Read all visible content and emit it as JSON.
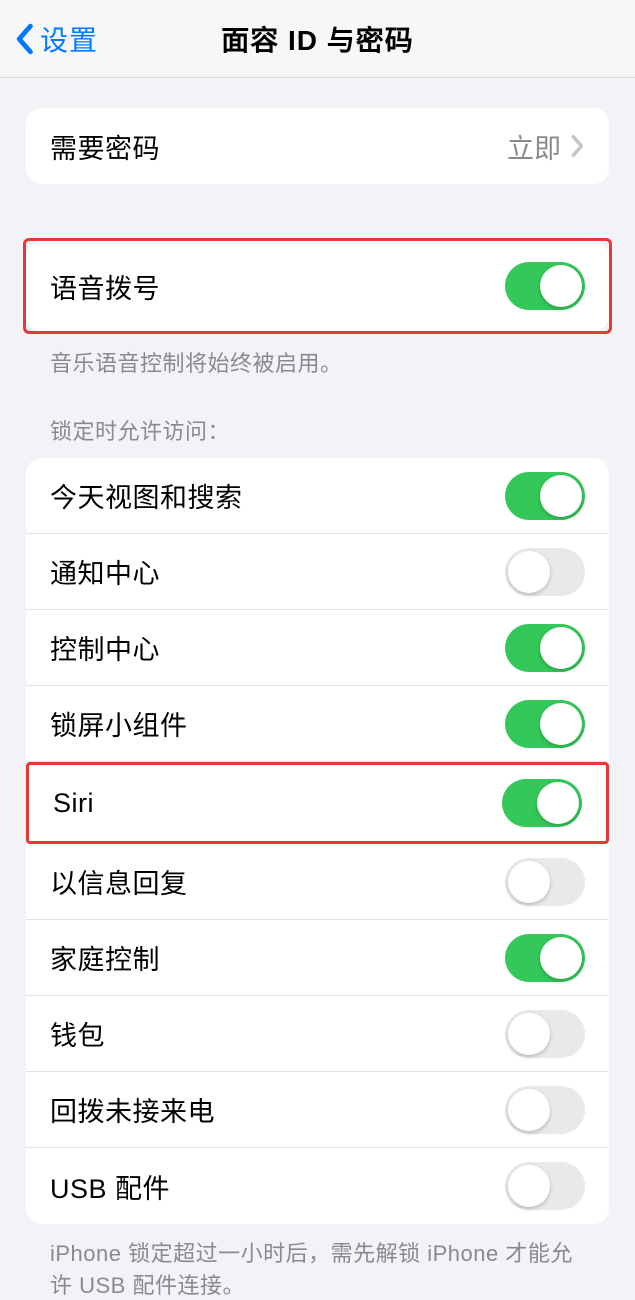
{
  "nav": {
    "back_label": "设置",
    "title": "面容 ID 与密码"
  },
  "require_passcode": {
    "label": "需要密码",
    "value": "立即"
  },
  "voice_dial": {
    "label": "语音拨号",
    "on": true,
    "footer": "音乐语音控制将始终被启用。"
  },
  "allow_access": {
    "header": "锁定时允许访问：",
    "items": [
      {
        "label": "今天视图和搜索",
        "on": true
      },
      {
        "label": "通知中心",
        "on": false
      },
      {
        "label": "控制中心",
        "on": true
      },
      {
        "label": "锁屏小组件",
        "on": true
      },
      {
        "label": "Siri",
        "on": true
      },
      {
        "label": "以信息回复",
        "on": false
      },
      {
        "label": "家庭控制",
        "on": true
      },
      {
        "label": "钱包",
        "on": false
      },
      {
        "label": "回拨未接来电",
        "on": false
      },
      {
        "label": "USB 配件",
        "on": false
      }
    ],
    "footer": "iPhone 锁定超过一小时后，需先解锁 iPhone 才能允许 USB 配件连接。"
  }
}
